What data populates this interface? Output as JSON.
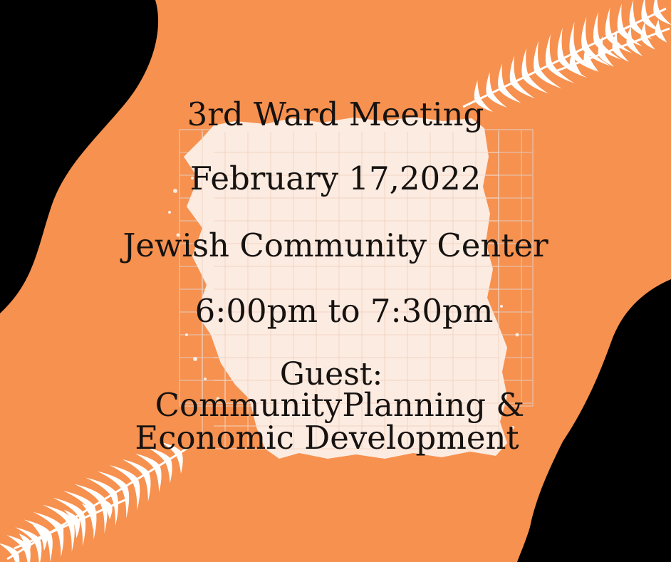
{
  "event": {
    "title": "3rd Ward Meeting",
    "date": "February 17,2022",
    "location": "Jewish Community Center",
    "time": "6:00pm to 7:30pm",
    "guest_label": "Guest:",
    "guest_line1": "CommunityPlanning &",
    "guest_line2": "Economic Development"
  },
  "colors": {
    "background": "#f7914f",
    "blob": "#000000",
    "paper": "#fcebe1",
    "grid": "#e8b79a",
    "text": "#161210",
    "leaves": "#ffffff"
  },
  "decor": {
    "top_left": "black-blob",
    "bottom_right": "black-blob",
    "top_right": "palm-leaf-icon",
    "bottom_left": "palm-leaf-icon",
    "center": "torn-paper-grid"
  }
}
